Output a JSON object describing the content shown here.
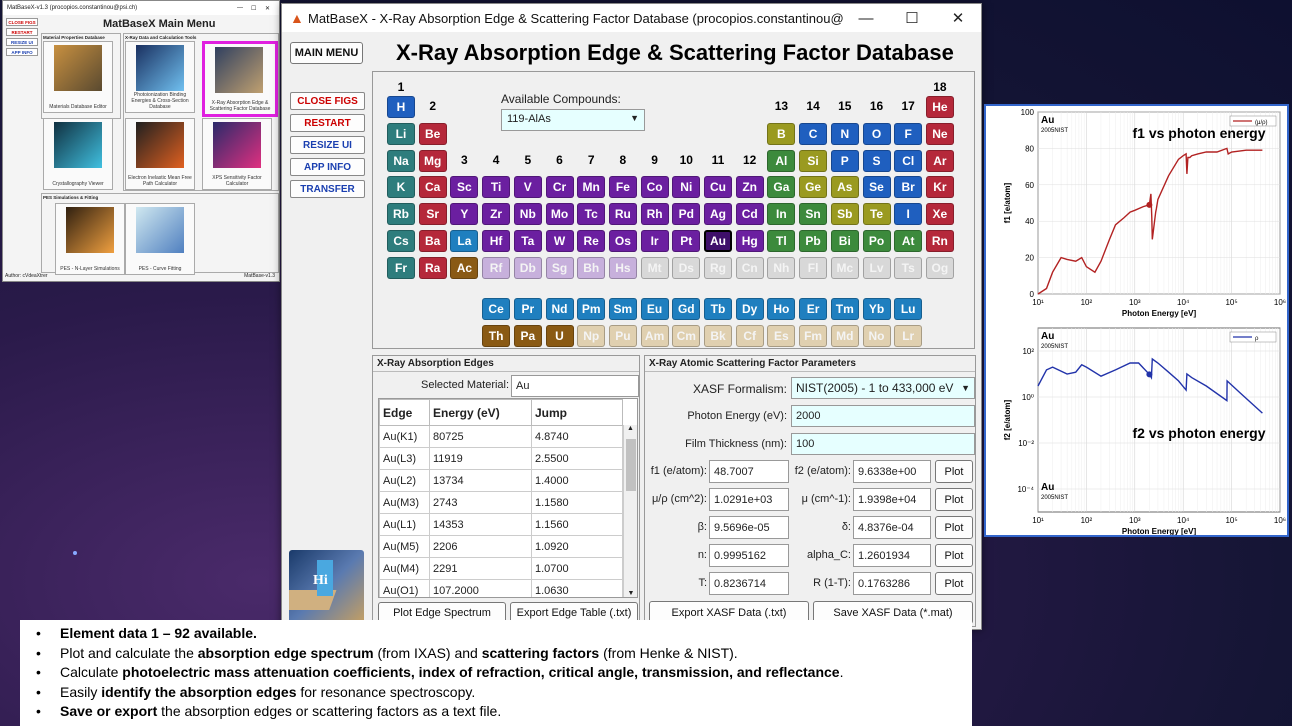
{
  "mainmenu_window": {
    "title": "MatBaseX-v1.3 (procopios.constantinou@psi.ch)",
    "heading": "MatBaseX Main Menu",
    "side_buttons": [
      "CLOSE FIGS",
      "RESTART",
      "RESIZE UI",
      "APP INFO"
    ],
    "section_titles": [
      "Material Properties Database",
      "X-Ray Data and Calculation Tools",
      "PES Simulations & Fitting"
    ],
    "tools": [
      "Materials Database Editor",
      "Photoionization Binding Energies & Cross-Section Database",
      "X-Ray Absorption Edge & Scattering Factor Database",
      "Crystallography Viewer",
      "Electron Inelastic Mean Free Path Calculator",
      "XPS Sensitivity Factor Calculator",
      "PES - N-Layer Simulations",
      "PES - Curve Fitting"
    ],
    "author": "Author: cVdeaXtrer",
    "version": "MatBase-v1.3"
  },
  "main_window": {
    "title": "MatBaseX - X-Ray Absorption Edge & Scattering Factor Database (procopios.constantinou@psi.ch)",
    "heading": "X-Ray Absorption Edge & Scattering Factor Database",
    "main_menu_label": "MAIN MENU",
    "side_buttons": [
      "CLOSE FIGS",
      "RESTART",
      "RESIZE UI",
      "APP INFO",
      "TRANSFER"
    ],
    "available_compounds_label": "Available Compounds:",
    "compound_selected": "119-AlAs",
    "group_numbers": [
      "1",
      "2",
      "3",
      "4",
      "5",
      "6",
      "7",
      "8",
      "9",
      "10",
      "11",
      "12",
      "13",
      "14",
      "15",
      "16",
      "17",
      "18"
    ]
  },
  "periodic_table": [
    {
      "s": "H",
      "c": "#1f5fbf",
      "r": 0,
      "g": 0
    },
    {
      "s": "He",
      "c": "#b5283a",
      "r": 0,
      "g": 17
    },
    {
      "s": "Li",
      "c": "#2e7d7d",
      "r": 1,
      "g": 0
    },
    {
      "s": "Be",
      "c": "#b5283a",
      "r": 1,
      "g": 1
    },
    {
      "s": "B",
      "c": "#9a9a20",
      "r": 1,
      "g": 12
    },
    {
      "s": "C",
      "c": "#1f5fbf",
      "r": 1,
      "g": 13
    },
    {
      "s": "N",
      "c": "#1f5fbf",
      "r": 1,
      "g": 14
    },
    {
      "s": "O",
      "c": "#1f5fbf",
      "r": 1,
      "g": 15
    },
    {
      "s": "F",
      "c": "#1f5fbf",
      "r": 1,
      "g": 16
    },
    {
      "s": "Ne",
      "c": "#b5283a",
      "r": 1,
      "g": 17
    },
    {
      "s": "Na",
      "c": "#2e7d7d",
      "r": 2,
      "g": 0
    },
    {
      "s": "Mg",
      "c": "#b5283a",
      "r": 2,
      "g": 1
    },
    {
      "s": "Al",
      "c": "#3c8a3c",
      "r": 2,
      "g": 12
    },
    {
      "s": "Si",
      "c": "#9a9a20",
      "r": 2,
      "g": 13
    },
    {
      "s": "P",
      "c": "#1f5fbf",
      "r": 2,
      "g": 14
    },
    {
      "s": "S",
      "c": "#1f5fbf",
      "r": 2,
      "g": 15
    },
    {
      "s": "Cl",
      "c": "#1f5fbf",
      "r": 2,
      "g": 16
    },
    {
      "s": "Ar",
      "c": "#b5283a",
      "r": 2,
      "g": 17
    },
    {
      "s": "K",
      "c": "#2e7d7d",
      "r": 3,
      "g": 0
    },
    {
      "s": "Ca",
      "c": "#b5283a",
      "r": 3,
      "g": 1
    },
    {
      "s": "Sc",
      "c": "#6b1fa0",
      "r": 3,
      "g": 2
    },
    {
      "s": "Ti",
      "c": "#6b1fa0",
      "r": 3,
      "g": 3
    },
    {
      "s": "V",
      "c": "#6b1fa0",
      "r": 3,
      "g": 4
    },
    {
      "s": "Cr",
      "c": "#6b1fa0",
      "r": 3,
      "g": 5
    },
    {
      "s": "Mn",
      "c": "#6b1fa0",
      "r": 3,
      "g": 6
    },
    {
      "s": "Fe",
      "c": "#6b1fa0",
      "r": 3,
      "g": 7
    },
    {
      "s": "Co",
      "c": "#6b1fa0",
      "r": 3,
      "g": 8
    },
    {
      "s": "Ni",
      "c": "#6b1fa0",
      "r": 3,
      "g": 9
    },
    {
      "s": "Cu",
      "c": "#6b1fa0",
      "r": 3,
      "g": 10
    },
    {
      "s": "Zn",
      "c": "#6b1fa0",
      "r": 3,
      "g": 11
    },
    {
      "s": "Ga",
      "c": "#3c8a3c",
      "r": 3,
      "g": 12
    },
    {
      "s": "Ge",
      "c": "#9a9a20",
      "r": 3,
      "g": 13
    },
    {
      "s": "As",
      "c": "#9a9a20",
      "r": 3,
      "g": 14
    },
    {
      "s": "Se",
      "c": "#1f5fbf",
      "r": 3,
      "g": 15
    },
    {
      "s": "Br",
      "c": "#1f5fbf",
      "r": 3,
      "g": 16
    },
    {
      "s": "Kr",
      "c": "#b5283a",
      "r": 3,
      "g": 17
    },
    {
      "s": "Rb",
      "c": "#2e7d7d",
      "r": 4,
      "g": 0
    },
    {
      "s": "Sr",
      "c": "#b5283a",
      "r": 4,
      "g": 1
    },
    {
      "s": "Y",
      "c": "#6b1fa0",
      "r": 4,
      "g": 2
    },
    {
      "s": "Zr",
      "c": "#6b1fa0",
      "r": 4,
      "g": 3
    },
    {
      "s": "Nb",
      "c": "#6b1fa0",
      "r": 4,
      "g": 4
    },
    {
      "s": "Mo",
      "c": "#6b1fa0",
      "r": 4,
      "g": 5
    },
    {
      "s": "Tc",
      "c": "#6b1fa0",
      "r": 4,
      "g": 6
    },
    {
      "s": "Ru",
      "c": "#6b1fa0",
      "r": 4,
      "g": 7
    },
    {
      "s": "Rh",
      "c": "#6b1fa0",
      "r": 4,
      "g": 8
    },
    {
      "s": "Pd",
      "c": "#6b1fa0",
      "r": 4,
      "g": 9
    },
    {
      "s": "Ag",
      "c": "#6b1fa0",
      "r": 4,
      "g": 10
    },
    {
      "s": "Cd",
      "c": "#6b1fa0",
      "r": 4,
      "g": 11
    },
    {
      "s": "In",
      "c": "#3c8a3c",
      "r": 4,
      "g": 12
    },
    {
      "s": "Sn",
      "c": "#3c8a3c",
      "r": 4,
      "g": 13
    },
    {
      "s": "Sb",
      "c": "#9a9a20",
      "r": 4,
      "g": 14
    },
    {
      "s": "Te",
      "c": "#9a9a20",
      "r": 4,
      "g": 15
    },
    {
      "s": "I",
      "c": "#1f5fbf",
      "r": 4,
      "g": 16
    },
    {
      "s": "Xe",
      "c": "#b5283a",
      "r": 4,
      "g": 17
    },
    {
      "s": "Cs",
      "c": "#2e7d7d",
      "r": 5,
      "g": 0
    },
    {
      "s": "Ba",
      "c": "#b5283a",
      "r": 5,
      "g": 1
    },
    {
      "s": "La",
      "c": "#1f7fbf",
      "r": 5,
      "g": 2
    },
    {
      "s": "Hf",
      "c": "#6b1fa0",
      "r": 5,
      "g": 3
    },
    {
      "s": "Ta",
      "c": "#6b1fa0",
      "r": 5,
      "g": 4
    },
    {
      "s": "W",
      "c": "#6b1fa0",
      "r": 5,
      "g": 5
    },
    {
      "s": "Re",
      "c": "#6b1fa0",
      "r": 5,
      "g": 6
    },
    {
      "s": "Os",
      "c": "#6b1fa0",
      "r": 5,
      "g": 7
    },
    {
      "s": "Ir",
      "c": "#6b1fa0",
      "r": 5,
      "g": 8
    },
    {
      "s": "Pt",
      "c": "#6b1fa0",
      "r": 5,
      "g": 9
    },
    {
      "s": "Au",
      "c": "#3e0f6a",
      "r": 5,
      "g": 10
    },
    {
      "s": "Hg",
      "c": "#6b1fa0",
      "r": 5,
      "g": 11
    },
    {
      "s": "Tl",
      "c": "#3c8a3c",
      "r": 5,
      "g": 12
    },
    {
      "s": "Pb",
      "c": "#3c8a3c",
      "r": 5,
      "g": 13
    },
    {
      "s": "Bi",
      "c": "#3c8a3c",
      "r": 5,
      "g": 14
    },
    {
      "s": "Po",
      "c": "#3c8a3c",
      "r": 5,
      "g": 15
    },
    {
      "s": "At",
      "c": "#3c8a3c",
      "r": 5,
      "g": 16
    },
    {
      "s": "Rn",
      "c": "#b5283a",
      "r": 5,
      "g": 17
    },
    {
      "s": "Fr",
      "c": "#2e7d7d",
      "r": 6,
      "g": 0
    },
    {
      "s": "Ra",
      "c": "#b5283a",
      "r": 6,
      "g": 1
    },
    {
      "s": "Ac",
      "c": "#8a5a14",
      "r": 6,
      "g": 2
    },
    {
      "s": "Rf",
      "c": "#c7b0dc",
      "r": 6,
      "g": 3
    },
    {
      "s": "Db",
      "c": "#c7b0dc",
      "r": 6,
      "g": 4
    },
    {
      "s": "Sg",
      "c": "#c7b0dc",
      "r": 6,
      "g": 5
    },
    {
      "s": "Bh",
      "c": "#c7b0dc",
      "r": 6,
      "g": 6
    },
    {
      "s": "Hs",
      "c": "#c7b0dc",
      "r": 6,
      "g": 7
    },
    {
      "s": "Mt",
      "c": "#d8d8d8",
      "r": 6,
      "g": 8
    },
    {
      "s": "Ds",
      "c": "#d8d8d8",
      "r": 6,
      "g": 9
    },
    {
      "s": "Rg",
      "c": "#d8d8d8",
      "r": 6,
      "g": 10
    },
    {
      "s": "Cn",
      "c": "#d8d8d8",
      "r": 6,
      "g": 11
    },
    {
      "s": "Nh",
      "c": "#d8d8d8",
      "r": 6,
      "g": 12
    },
    {
      "s": "Fl",
      "c": "#d8d8d8",
      "r": 6,
      "g": 13
    },
    {
      "s": "Mc",
      "c": "#d8d8d8",
      "r": 6,
      "g": 14
    },
    {
      "s": "Lv",
      "c": "#d8d8d8",
      "r": 6,
      "g": 15
    },
    {
      "s": "Ts",
      "c": "#d8d8d8",
      "r": 6,
      "g": 16
    },
    {
      "s": "Og",
      "c": "#d8d8d8",
      "r": 6,
      "g": 17
    },
    {
      "s": "Ce",
      "c": "#1f7fbf",
      "r": 7,
      "g": 3
    },
    {
      "s": "Pr",
      "c": "#1f7fbf",
      "r": 7,
      "g": 4
    },
    {
      "s": "Nd",
      "c": "#1f7fbf",
      "r": 7,
      "g": 5
    },
    {
      "s": "Pm",
      "c": "#1f7fbf",
      "r": 7,
      "g": 6
    },
    {
      "s": "Sm",
      "c": "#1f7fbf",
      "r": 7,
      "g": 7
    },
    {
      "s": "Eu",
      "c": "#1f7fbf",
      "r": 7,
      "g": 8
    },
    {
      "s": "Gd",
      "c": "#1f7fbf",
      "r": 7,
      "g": 9
    },
    {
      "s": "Tb",
      "c": "#1f7fbf",
      "r": 7,
      "g": 10
    },
    {
      "s": "Dy",
      "c": "#1f7fbf",
      "r": 7,
      "g": 11
    },
    {
      "s": "Ho",
      "c": "#1f7fbf",
      "r": 7,
      "g": 12
    },
    {
      "s": "Er",
      "c": "#1f7fbf",
      "r": 7,
      "g": 13
    },
    {
      "s": "Tm",
      "c": "#1f7fbf",
      "r": 7,
      "g": 14
    },
    {
      "s": "Yb",
      "c": "#1f7fbf",
      "r": 7,
      "g": 15
    },
    {
      "s": "Lu",
      "c": "#1f7fbf",
      "r": 7,
      "g": 16
    },
    {
      "s": "Th",
      "c": "#8a5a14",
      "r": 8,
      "g": 3
    },
    {
      "s": "Pa",
      "c": "#8a5a14",
      "r": 8,
      "g": 4
    },
    {
      "s": "U",
      "c": "#8a5a14",
      "r": 8,
      "g": 5
    },
    {
      "s": "Np",
      "c": "#e0d0b0",
      "r": 8,
      "g": 6
    },
    {
      "s": "Pu",
      "c": "#e0d0b0",
      "r": 8,
      "g": 7
    },
    {
      "s": "Am",
      "c": "#e0d0b0",
      "r": 8,
      "g": 8
    },
    {
      "s": "Cm",
      "c": "#e0d0b0",
      "r": 8,
      "g": 9
    },
    {
      "s": "Bk",
      "c": "#e0d0b0",
      "r": 8,
      "g": 10
    },
    {
      "s": "Cf",
      "c": "#e0d0b0",
      "r": 8,
      "g": 11
    },
    {
      "s": "Es",
      "c": "#e0d0b0",
      "r": 8,
      "g": 12
    },
    {
      "s": "Fm",
      "c": "#e0d0b0",
      "r": 8,
      "g": 13
    },
    {
      "s": "Md",
      "c": "#e0d0b0",
      "r": 8,
      "g": 14
    },
    {
      "s": "No",
      "c": "#e0d0b0",
      "r": 8,
      "g": 15
    },
    {
      "s": "Lr",
      "c": "#e0d0b0",
      "r": 8,
      "g": 16
    }
  ],
  "edges_panel": {
    "title": "X-Ray Absorption Edges",
    "selected_label": "Selected Material:",
    "selected_value": "Au",
    "headers": [
      "Edge",
      "Energy (eV)",
      "Jump"
    ],
    "rows": [
      [
        "Au(K1)",
        "80725",
        "4.8740"
      ],
      [
        "Au(L3)",
        "11919",
        "2.5500"
      ],
      [
        "Au(L2)",
        "13734",
        "1.4000"
      ],
      [
        "Au(M3)",
        "2743",
        "1.1580"
      ],
      [
        "Au(L1)",
        "14353",
        "1.1560"
      ],
      [
        "Au(M5)",
        "2206",
        "1.0920"
      ],
      [
        "Au(M4)",
        "2291",
        "1.0700"
      ],
      [
        "Au(O1)",
        "107.2000",
        "1.0630"
      ]
    ],
    "plot_btn": "Plot Edge Spectrum",
    "export_btn": "Export Edge Table (.txt)"
  },
  "xasf_panel": {
    "title": "X-Ray Atomic Scattering Factor Parameters",
    "formalism_label": "XASF Formalism:",
    "formalism_value": "NIST(2005) - 1 to 433,000 eV",
    "energy_label": "Photon Energy (eV):",
    "energy_value": "2000",
    "thickness_label": "Film Thickness (nm):",
    "thickness_value": "100",
    "params": [
      {
        "l1": "f1 (e/atom):",
        "v1": "48.7007",
        "l2": "f2 (e/atom):",
        "v2": "9.6338e+00"
      },
      {
        "l1": "μ/ρ (cm^2):",
        "v1": "1.0291e+03",
        "l2": "μ (cm^-1):",
        "v2": "1.9398e+04"
      },
      {
        "l1": "β:",
        "v1": "9.5696e-05",
        "l2": "δ:",
        "v2": "4.8376e-04"
      },
      {
        "l1": "n:",
        "v1": "0.9995162",
        "l2": "alpha_C:",
        "v2": "1.2601934"
      },
      {
        "l1": "T:",
        "v1": "0.8236714",
        "l2": "R (1-T):",
        "v2": "0.1763286"
      }
    ],
    "plot_label": "Plot",
    "export_btn": "Export XASF Data (.txt)",
    "save_btn": "Save XASF Data (*.mat)"
  },
  "plot_window": {
    "plot1": {
      "element": "Au",
      "source": "2005NIST",
      "title": "f1 vs photon energy",
      "legend": "(μ/ρ)",
      "ylabel": "f1 [e/atom]",
      "xlabel": "Photon Energy [eV]",
      "yticks": [
        "0",
        "20",
        "40",
        "60",
        "80",
        "100"
      ],
      "xticks": [
        "10¹",
        "10²",
        "10³",
        "10⁴",
        "10⁵",
        "10⁶"
      ]
    },
    "plot2": {
      "element": "Au",
      "source": "2005NIST",
      "title": "f2 vs photon energy",
      "legend": "ρ",
      "ylabel": "f2 [e/atom]",
      "xlabel": "Photon Energy [eV]",
      "yticks": [
        "10²",
        "10⁰",
        "10⁻²",
        "10⁻⁴"
      ],
      "xticks": [
        "10¹",
        "10²",
        "10³",
        "10⁴",
        "10⁵",
        "10⁶"
      ]
    }
  },
  "chart_data": [
    {
      "type": "line",
      "title": "f1 vs photon energy",
      "xlabel": "Photon Energy [eV]",
      "ylabel": "f1 [e/atom]",
      "xscale": "log",
      "xlim": [
        10,
        1000000
      ],
      "ylim": [
        0,
        100
      ],
      "series": [
        {
          "name": "(μ/ρ)",
          "x": [
            10,
            15,
            20,
            30,
            40,
            60,
            80,
            100,
            150,
            200,
            300,
            400,
            600,
            800,
            1000,
            1500,
            2000,
            2150,
            2250,
            2300,
            2700,
            2800,
            3000,
            5000,
            8000,
            10000,
            11500,
            11900,
            12500,
            13700,
            15000,
            20000,
            30000,
            50000,
            80000,
            85000,
            100000,
            200000,
            433000
          ],
          "y": [
            0,
            3,
            12,
            20,
            19,
            18,
            20,
            15,
            12,
            18,
            30,
            38,
            42,
            45,
            46,
            48,
            49,
            55,
            42,
            30,
            45,
            47,
            52,
            65,
            74,
            76,
            77,
            66,
            75,
            75,
            76,
            77,
            78,
            78,
            80,
            77,
            78,
            79,
            79
          ]
        }
      ],
      "marker": {
        "x": 2000,
        "y": 49
      }
    },
    {
      "type": "line",
      "title": "f2 vs photon energy",
      "xlabel": "Photon Energy [eV]",
      "ylabel": "f2 [e/atom]",
      "xscale": "log",
      "yscale": "log",
      "xlim": [
        10,
        1000000
      ],
      "ylim": [
        1e-05,
        1000
      ],
      "series": [
        {
          "name": "ρ",
          "x": [
            10,
            15,
            20,
            40,
            60,
            80,
            100,
            200,
            400,
            800,
            1200,
            2000,
            2200,
            2300,
            3000,
            5000,
            8000,
            11500,
            11900,
            15000,
            30000,
            80000,
            80725,
            150000,
            433000
          ],
          "y": [
            3,
            15,
            20,
            10,
            12,
            25,
            20,
            8,
            15,
            30,
            30,
            9.6,
            7,
            45,
            30,
            12,
            5,
            2,
            10,
            7,
            3,
            0.7,
            5,
            1.5,
            0.2
          ]
        }
      ],
      "marker": {
        "x": 2000,
        "y": 9.6
      }
    }
  ],
  "bullets": [
    [
      {
        "b": true,
        "t": "Element data 1 – 92 available."
      }
    ],
    [
      {
        "b": false,
        "t": "Plot and calculate the "
      },
      {
        "b": true,
        "t": "absorption edge spectrum"
      },
      {
        "b": false,
        "t": " (from IXAS) and "
      },
      {
        "b": true,
        "t": "scattering factors"
      },
      {
        "b": false,
        "t": " (from Henke & NIST)."
      }
    ],
    [
      {
        "b": false,
        "t": "Calculate "
      },
      {
        "b": true,
        "t": "photoelectric mass attenuation coefficients, index of refraction, critical angle, transmission, and reflectance"
      },
      {
        "b": false,
        "t": "."
      }
    ],
    [
      {
        "b": false,
        "t": "Easily "
      },
      {
        "b": true,
        "t": "identify the absorption edges"
      },
      {
        "b": false,
        "t": " for resonance spectroscopy."
      }
    ],
    [
      {
        "b": true,
        "t": "Save or export"
      },
      {
        "b": false,
        "t": " the absorption edges or scattering factors as a text file."
      }
    ]
  ]
}
